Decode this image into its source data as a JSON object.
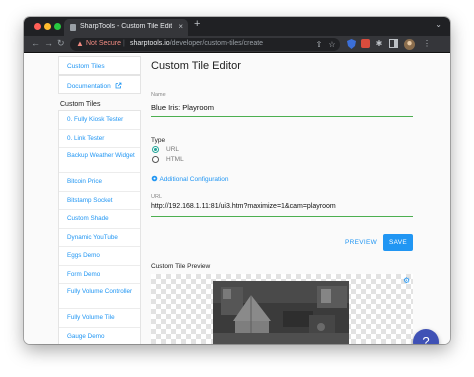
{
  "browser": {
    "tab_title": "SharpTools - Custom Tile Editor",
    "tab_close": "×",
    "new_tab": "+",
    "security_label": "Not Secure",
    "url_host": "sharptools.io",
    "url_path": "/developer/custom-tiles/create"
  },
  "sidebar": {
    "custom_tiles_link": "Custom Tiles",
    "documentation_link": "Documentation",
    "section_title": "Custom Tiles",
    "items": [
      "0. Fully Kiosk Tester",
      "0. Link Tester",
      "Backup Weather Widget",
      "Bitcoin Price",
      "Bitstamp Socket",
      "Custom Shade",
      "Dynamic YouTube",
      "Eggs Demo",
      "Form Demo",
      "Fully Volume Controller",
      "Fully Volume Tile",
      "Gauge Demo"
    ]
  },
  "editor": {
    "title": "Custom Tile Editor",
    "name_label": "Name",
    "name_value": "Blue Iris: Playroom",
    "type_label": "Type",
    "type_options": [
      "URL",
      "HTML"
    ],
    "type_selected": "URL",
    "additional_config": "Additional Configuration",
    "url_label": "URL",
    "url_value": "http://192.168.1.11:81/ui3.htm?maximize=1&cam=playroom",
    "preview_button": "PREVIEW",
    "save_button": "SAVE",
    "preview_title": "Custom Tile Preview"
  },
  "help_button": "?",
  "colors": {
    "accent": "#2196f3",
    "input_underline": "#4caf50",
    "radio_selected": "#26a69a",
    "help_fab": "#3f51b5"
  },
  "icons": [
    "shield-icon",
    "external-link-icon",
    "gear-icon",
    "warning-icon",
    "extensions-icon"
  ]
}
